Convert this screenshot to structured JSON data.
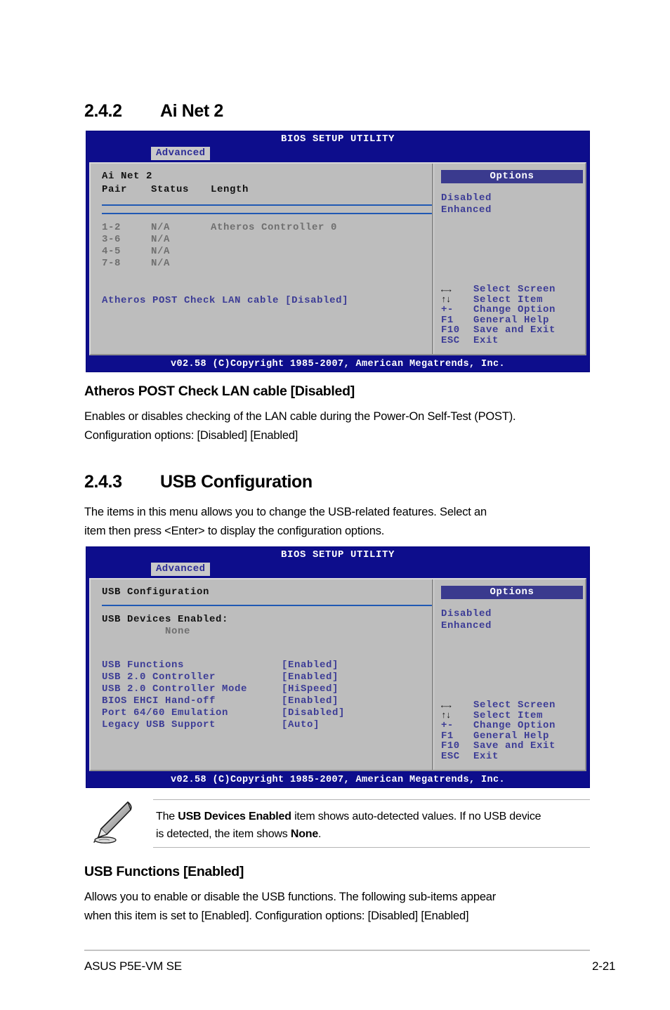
{
  "sections": {
    "ainet": {
      "number": "2.4.2",
      "title": "Ai Net 2"
    },
    "usb": {
      "number": "2.4.3",
      "title": "USB Configuration"
    }
  },
  "bios_screen_1": {
    "title": "BIOS SETUP UTILITY",
    "tab": "Advanced",
    "menu_title": "Ai Net 2",
    "columns": [
      "Pair",
      "Status",
      "Length"
    ],
    "rows": [
      {
        "pair": "1-2",
        "status": "N/A",
        "length": "Atheros Controller 0"
      },
      {
        "pair": "3-6",
        "status": "N/A",
        "length": ""
      },
      {
        "pair": "4-5",
        "status": "N/A",
        "length": ""
      },
      {
        "pair": "7-8",
        "status": "N/A",
        "length": ""
      }
    ],
    "setting": {
      "label": "Atheros POST Check LAN cable",
      "value": "[Disabled]"
    },
    "options": {
      "header": "Options",
      "items": [
        "Disabled",
        "Enhanced"
      ]
    },
    "navkeys": [
      {
        "key": "←→",
        "label": "Select Screen"
      },
      {
        "key": "↑↓",
        "label": "Select Item"
      },
      {
        "key": "+-",
        "label": "Change Option"
      },
      {
        "key": "F1",
        "label": "General Help"
      },
      {
        "key": "F10",
        "label": "Save and Exit"
      },
      {
        "key": "ESC",
        "label": "Exit"
      }
    ],
    "footer": "v02.58 (C)Copyright 1985-2007, American Megatrends, Inc."
  },
  "bios_screen_2": {
    "title": "BIOS SETUP UTILITY",
    "tab": "Advanced",
    "menu_title": "USB Configuration",
    "devices_label": "USB Devices Enabled:",
    "devices_value": "None",
    "items": [
      {
        "label": "USB Functions",
        "value": "[Enabled]"
      },
      {
        "label": "USB 2.0 Controller",
        "value": "[Enabled]"
      },
      {
        "label": "USB 2.0 Controller Mode",
        "value": "[HiSpeed]"
      },
      {
        "label": "BIOS EHCI Hand-off",
        "value": "[Enabled]"
      },
      {
        "label": "Port 64/60 Emulation",
        "value": "[Disabled]"
      },
      {
        "label": "Legacy USB Support",
        "value": "[Auto]"
      }
    ],
    "options": {
      "header": "Options",
      "items": [
        "Disabled",
        "Enhanced"
      ]
    },
    "navkeys": [
      {
        "key": "←→",
        "label": "Select Screen"
      },
      {
        "key": "↑↓",
        "label": "Select Item"
      },
      {
        "key": "+-",
        "label": "Change Option"
      },
      {
        "key": "F1",
        "label": "General Help"
      },
      {
        "key": "F10",
        "label": "Save and Exit"
      },
      {
        "key": "ESC",
        "label": "Exit"
      }
    ],
    "footer": "v02.58 (C)Copyright 1985-2007, American Megatrends, Inc."
  },
  "item_atheros": {
    "heading": "Atheros POST Check LAN cable [Disabled]",
    "line1": "Enables or disables checking of the LAN cable during the Power-On Self-Test (POST).",
    "line2": "Configuration options: [Disabled] [Enabled]"
  },
  "usb_intro": {
    "line1": "The items in this menu allows you to change the USB-related features. Select an",
    "line2": "item then press <Enter> to display the configuration options."
  },
  "note": {
    "line1_pre": "The ",
    "line1_bold": "USB Devices Enabled",
    "line1_post": " item shows auto-detected values. If no USB device",
    "line2_pre": "is detected, the item shows ",
    "line2_bold": "None",
    "line2_post": "."
  },
  "item_usb_functions": {
    "heading": "USB Functions [Enabled]",
    "line1": "Allows you to enable or disable the USB functions. The following sub-items appear",
    "line2": "when this item is set to [Enabled]. Configuration options: [Disabled] [Enabled]"
  },
  "page_footer": {
    "product": "ASUS P5E-VM SE",
    "page": "2-21"
  }
}
